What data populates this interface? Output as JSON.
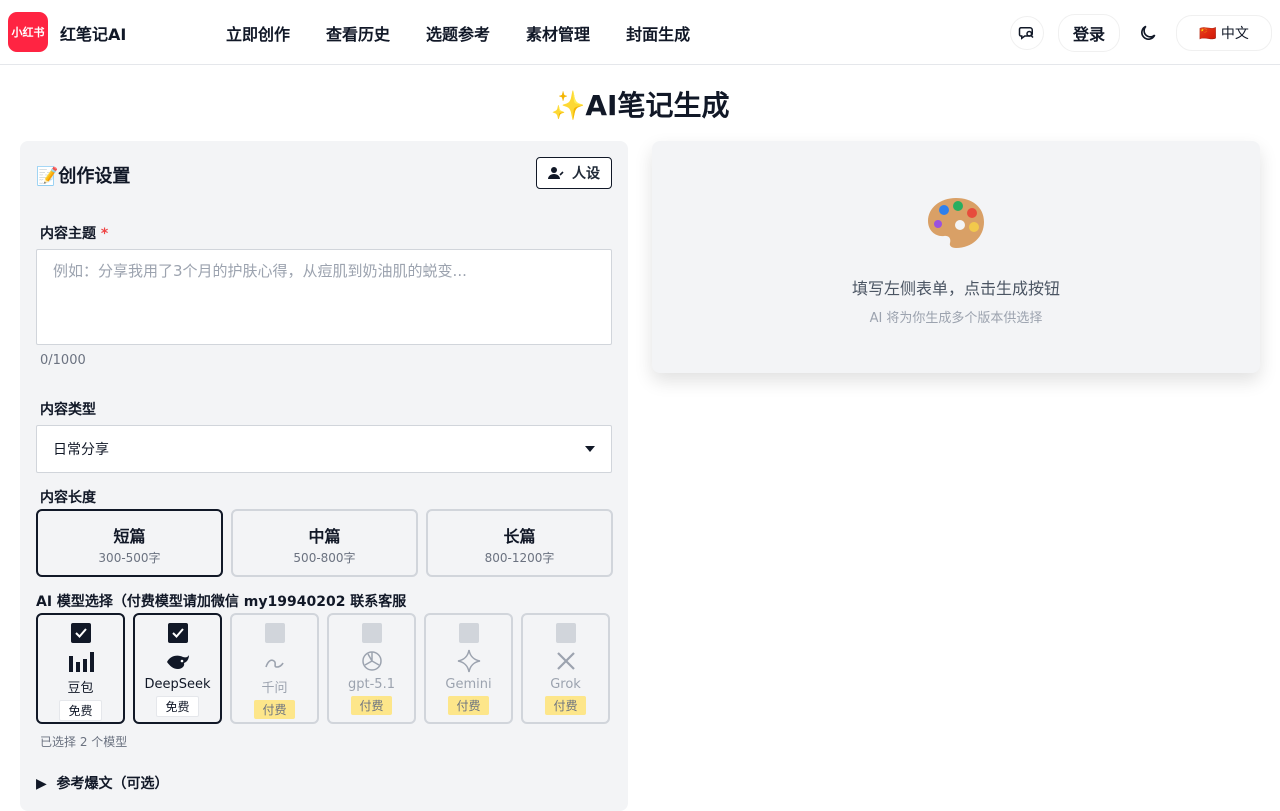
{
  "nav": {
    "logo_text": "小红书",
    "brand": "红笔记AI",
    "menu": [
      "立即创作",
      "查看历史",
      "选题参考",
      "素材管理",
      "封面生成"
    ],
    "login": "登录",
    "lang": "🇨🇳 中文",
    "icons": [
      "chat-icon",
      "moon-icon"
    ]
  },
  "page_title": "✨AI笔记生成",
  "form": {
    "heading": "📝创作设置",
    "persona_button": "人设",
    "topic_label": "内容主题",
    "topic_required": "*",
    "topic_placeholder": "例如：分享我用了3个月的护肤心得，从痘肌到奶油肌的蜕变...",
    "topic_counter": "0/1000",
    "type_label": "内容类型",
    "type_value": "日常分享",
    "length_label": "内容长度",
    "lengths": [
      {
        "title": "短篇",
        "sub": "300-500字",
        "active": true
      },
      {
        "title": "中篇",
        "sub": "500-800字",
        "active": false
      },
      {
        "title": "长篇",
        "sub": "800-1200字",
        "active": false
      }
    ],
    "model_label": "AI 模型选择（付费模型请加微信 my19940202 联系客服",
    "models": [
      {
        "name": "豆包",
        "tag": "免费",
        "selected": true,
        "icon": "doubao-icon"
      },
      {
        "name": "DeepSeek",
        "tag": "免费",
        "selected": true,
        "icon": "deepseek-icon"
      },
      {
        "name": "千问",
        "tag": "付费",
        "selected": false,
        "icon": "qwen-icon"
      },
      {
        "name": "gpt-5.1",
        "tag": "付费",
        "selected": false,
        "icon": "openai-icon"
      },
      {
        "name": "Gemini",
        "tag": "付费",
        "selected": false,
        "icon": "gemini-icon"
      },
      {
        "name": "Grok",
        "tag": "付费",
        "selected": false,
        "icon": "grok-icon"
      }
    ],
    "selected_count": "已选择 2 个模型",
    "reference_toggle": "参考爆文（可选）"
  },
  "result": {
    "emoji": "🎨",
    "title": "填写左侧表单，点击生成按钮",
    "subtitle": "AI 将为你生成多个版本供选择"
  },
  "colors": {
    "brand": "#ff2442",
    "paid_tag": "#fde68a",
    "dark": "#111827"
  }
}
